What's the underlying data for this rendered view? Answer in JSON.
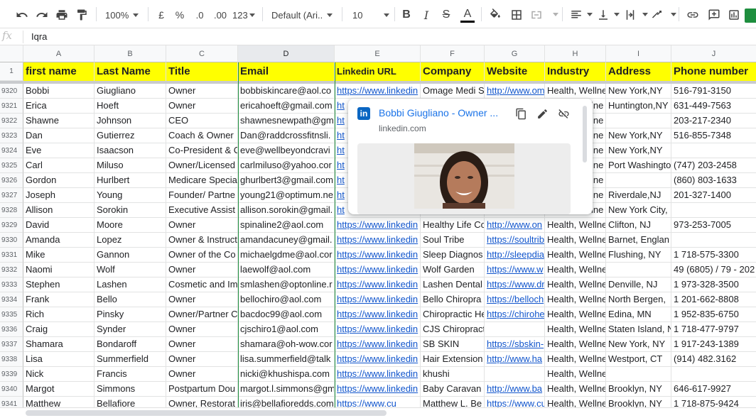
{
  "toolbar": {
    "zoom": "100%",
    "currency": "£",
    "percent": "%",
    "dec_less": ".0",
    "dec_more": ".00",
    "more_formats": "123",
    "font": "Default (Ari...",
    "font_size": "10",
    "bold": "B",
    "italic": "I",
    "strike": "S",
    "text_color": "A",
    "text_color_bar": "#000000",
    "icons": [
      "undo-icon",
      "redo-icon",
      "print-icon",
      "paint-format-icon",
      "fill-color-icon",
      "borders-icon",
      "merge-cells-icon",
      "horizontal-align-icon",
      "vertical-align-icon",
      "text-wrap-icon",
      "text-rotate-icon",
      "link-icon",
      "comment-icon",
      "chart-icon"
    ]
  },
  "formula_bar": {
    "fx": "fx",
    "value": "Iqra"
  },
  "columns": [
    "A",
    "B",
    "C",
    "D",
    "E",
    "F",
    "G",
    "H",
    "I",
    "J"
  ],
  "header_row": {
    "row_number": "1",
    "cells": [
      "first name",
      "Last Name",
      "Title",
      "Email",
      "Linkedin URL",
      "Company",
      "Website",
      "Industry",
      "Address",
      "Phone number"
    ]
  },
  "rows": [
    {
      "n": "9320",
      "c": [
        "Bobbi",
        "Giugliano",
        "Owner",
        "bobbiskincare@aol.co",
        "https://www.linkedin",
        "Omage Medi S",
        "http://www.om",
        "Health, Wellne",
        "New York,NY",
        "516-791-3150"
      ]
    },
    {
      "n": "9321",
      "c": [
        "Erica",
        "Hoeft",
        "Owner",
        "ericahoeft@gmail.com",
        "",
        "",
        "",
        "",
        "Huntington,NY",
        "631-449-7563"
      ]
    },
    {
      "n": "9322",
      "c": [
        "Shawne",
        "Johnson",
        "CEO",
        "shawnesnewpath@gm",
        "",
        "",
        "",
        "",
        "",
        "203-217-2340"
      ]
    },
    {
      "n": "9323",
      "c": [
        "Dan",
        "Gutierrez",
        "Coach & Owner",
        "Dan@raddcrossfitnsli.",
        "",
        "",
        "",
        "",
        "New York,NY",
        "516-855-7348"
      ]
    },
    {
      "n": "9324",
      "c": [
        "Eve",
        "Isaacson",
        "Co-President & C",
        "eve@wellbeyondcravi",
        "",
        "",
        "",
        "",
        "New York,NY",
        ""
      ]
    },
    {
      "n": "9325",
      "c": [
        "Carl",
        "Miluso",
        "Owner/Licensed",
        "carlmiluso@yahoo.cor",
        "",
        "",
        "",
        "",
        "Port Washingto",
        "(747) 203-2458"
      ]
    },
    {
      "n": "9326",
      "c": [
        "Gordon",
        "Hurlbert",
        "Medicare Specia",
        "ghurlbert3@gmail.com",
        "",
        "",
        "",
        "",
        "",
        "(860) 803-1633"
      ]
    },
    {
      "n": "9327",
      "c": [
        "Joseph",
        "Young",
        "Founder/ Partne",
        "young21@optimum.ne",
        "",
        "",
        "",
        "",
        "Riverdale,NJ",
        "201-327-1400"
      ]
    },
    {
      "n": "9328",
      "c": [
        "Allison",
        "Sorokin",
        "Executive Assist",
        "allison.sorokin@gmail.",
        "",
        "",
        "",
        "",
        "New York City,",
        ""
      ]
    },
    {
      "n": "9329",
      "c": [
        "David",
        "Moore",
        "Owner",
        "spinaline2@aol.com",
        "https://www.linkedin",
        "Healthy Life Co",
        "http://www.on",
        "Health, Wellne",
        "Clifton, NJ",
        "973-253-7005"
      ]
    },
    {
      "n": "9330",
      "c": [
        "Amanda",
        "Lopez",
        "Owner & Instruct",
        "amandacuney@gmail.",
        "https://www.linkedin",
        "Soul Tribe",
        "https://soultrib",
        "Health, Wellne",
        "Barnet, Englan",
        ""
      ]
    },
    {
      "n": "9331",
      "c": [
        "Mike",
        "Gannon",
        "Owner of the Co",
        "michaelgdme@aol.cor",
        "https://www.linkedin",
        "Sleep Diagnos",
        "http://sleepdia",
        "Health, Wellne",
        "Flushing, NY",
        "1 718-575-3300"
      ]
    },
    {
      "n": "9332",
      "c": [
        "Naomi",
        "Wolf",
        "Owner",
        "laewolf@aol.com",
        "https://www.linkedin",
        "Wolf Garden",
        "https://www.w",
        "Health, Wellne",
        "",
        "49 (6805) / 79 - 202"
      ]
    },
    {
      "n": "9333",
      "c": [
        "Stephen",
        "Lashen",
        "Cosmetic and Im",
        "smlashen@optonline.r",
        "https://www.linkedin",
        "Lashen Dental",
        "https://www.dr",
        "Health, Wellne",
        "Denville, NJ",
        "1 973-328-3500"
      ]
    },
    {
      "n": "9334",
      "c": [
        "Frank",
        "Bello",
        "Owner",
        "bellochiro@aol.com",
        "https://www.linkedin",
        "Bello Chiropra",
        "https://belloch",
        "Health, Wellne",
        "North Bergen,",
        "1 201-662-8808"
      ]
    },
    {
      "n": "9335",
      "c": [
        "Rich",
        "Pinsky",
        "Owner/Partner C",
        "bacdoc99@aol.com",
        "https://www.linkedin",
        "Chiropractic He",
        "https://chirohe",
        "Health, Wellne",
        "Edina, MN",
        "1 952-835-6750"
      ]
    },
    {
      "n": "9336",
      "c": [
        "Craig",
        "Synder",
        "Owner",
        "cjschiro1@aol.com",
        "https://www.linkedin",
        "CJS Chiropractic",
        "",
        "Health, Wellne",
        "Staten Island, N",
        "1 718-477-9797"
      ]
    },
    {
      "n": "9337",
      "c": [
        "Shamara",
        "Bondaroff",
        "Owner",
        "shamara@oh-wow.cor",
        "https://www.linkedin",
        "SB SKIN",
        "https://sbskin-",
        "Health, Wellne",
        "New York, NY",
        "1 917-243-1389"
      ]
    },
    {
      "n": "9338",
      "c": [
        "Lisa",
        "Summerfield",
        "Owner",
        "lisa.summerfield@talk",
        "https://www.linkedin",
        "Hair Extension",
        "http://www.ha",
        "Health, Wellne",
        "Westport, CT",
        "(914) 482.3162"
      ]
    },
    {
      "n": "9339",
      "c": [
        "Nick",
        "Francis",
        "Owner",
        "nicki@khushispa.com",
        "https://www.linkedin",
        "khushi",
        "",
        "Health, Wellne",
        "",
        ""
      ]
    },
    {
      "n": "9340",
      "c": [
        "Margot",
        "Simmons",
        "Postpartum Dou",
        "margot.l.simmons@gm",
        "https://www.linkedin",
        "Baby Caravan",
        "http://www.ba",
        "Health, Wellne",
        "Brooklyn, NY",
        "646-617-9927"
      ]
    },
    {
      "n": "9341",
      "c": [
        "Matthew",
        "Bellafiore",
        "Owner, Restorat",
        "iris@bellafioredds.com",
        "https://www.cu",
        "Matthew L. Be",
        "https://www.cu",
        "Health, Wellne",
        "Brooklyn, NY",
        "1 718-875-9424"
      ]
    }
  ],
  "partial": {
    "9321": "ht",
    "9322": "ht",
    "9323": "ht",
    "9324": "ht",
    "9325": "ht",
    "9326": "ht",
    "9327": "ht",
    "9328": "ht"
  },
  "partial_h": "lne",
  "link_card": {
    "title": "Bobbi Giugliano - Owner ...",
    "domain": "linkedin.com",
    "logo": "in"
  }
}
